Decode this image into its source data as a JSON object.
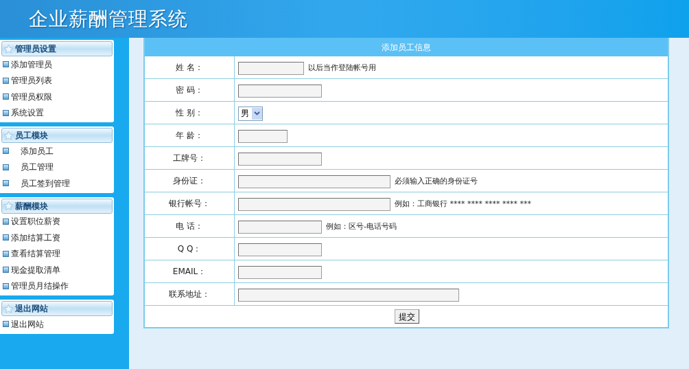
{
  "header": {
    "title": "企业薪酬管理系统"
  },
  "sidebar": {
    "groups": [
      {
        "title": "管理员设置",
        "items": [
          "添加管理员",
          "管理员列表",
          "管理员权限",
          "系统设置"
        ]
      },
      {
        "title": "员工模块",
        "items": [
          "添加员工",
          "员工管理",
          "员工签到管理"
        ]
      },
      {
        "title": "薪酬模块",
        "items": [
          "设置职位薪资",
          "添加结算工资",
          "查看结算管理",
          "现金提取清单",
          "管理员月结操作"
        ]
      },
      {
        "title": "退出网站",
        "items": [
          "退出网站"
        ]
      }
    ]
  },
  "form": {
    "title": "添加员工信息",
    "rows": [
      {
        "label": "姓 名：",
        "kind": "text",
        "hint": "以后当作登陆帐号用"
      },
      {
        "label": "密 码：",
        "kind": "text"
      },
      {
        "label": "性 别：",
        "kind": "select",
        "value": "男"
      },
      {
        "label": "年 龄：",
        "kind": "text"
      },
      {
        "label": "工牌号：",
        "kind": "text"
      },
      {
        "label": "身份证：",
        "kind": "text",
        "hint": "必须输入正确的身份证号"
      },
      {
        "label": "银行帐号：",
        "kind": "text",
        "hint": "例如：工商银行 **** **** **** **** ***"
      },
      {
        "label": "电 话：",
        "kind": "text",
        "hint": "例如：区号-电话号码"
      },
      {
        "label": "Q Q：",
        "kind": "text"
      },
      {
        "label": "EMAIL：",
        "kind": "text"
      },
      {
        "label": "联系地址：",
        "kind": "text"
      }
    ],
    "submit": "提交"
  }
}
